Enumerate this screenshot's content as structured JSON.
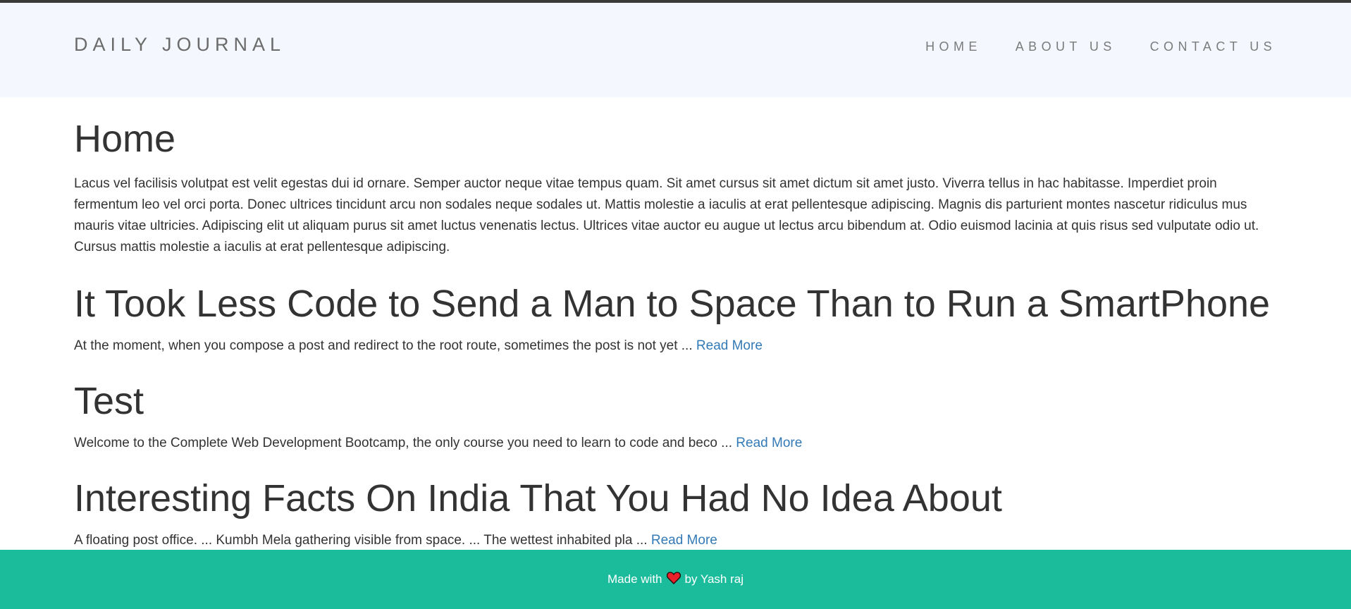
{
  "header": {
    "brand": "DAILY JOURNAL",
    "nav": [
      {
        "label": "HOME"
      },
      {
        "label": "ABOUT US"
      },
      {
        "label": "CONTACT US"
      }
    ]
  },
  "main": {
    "title": "Home",
    "intro": "Lacus vel facilisis volutpat est velit egestas dui id ornare. Semper auctor neque vitae tempus quam. Sit amet cursus sit amet dictum sit amet justo. Viverra tellus in hac habitasse. Imperdiet proin fermentum leo vel orci porta. Donec ultrices tincidunt arcu non sodales neque sodales ut. Mattis molestie a iaculis at erat pellentesque adipiscing. Magnis dis parturient montes nascetur ridiculus mus mauris vitae ultricies. Adipiscing elit ut aliquam purus sit amet luctus venenatis lectus. Ultrices vitae auctor eu augue ut lectus arcu bibendum at. Odio euismod lacinia at quis risus sed vulputate odio ut. Cursus mattis molestie a iaculis at erat pellentesque adipiscing.",
    "posts": [
      {
        "title": "It Took Less Code to Send a Man to Space Than to Run a SmartPhone",
        "excerpt": "At the moment, when you compose a post and redirect to the root route, sometimes the post is not yet ... ",
        "read_more": "Read More"
      },
      {
        "title": "Test",
        "excerpt": "Welcome to the Complete Web Development Bootcamp, the only course you need to learn to code and beco ... ",
        "read_more": "Read More"
      },
      {
        "title": "Interesting Facts On India That You Had No Idea About",
        "excerpt": "A floating post office. ... Kumbh Mela gathering visible from space. ... The wettest inhabited pla ... ",
        "read_more": "Read More"
      }
    ]
  },
  "footer": {
    "made_with": "Made with",
    "heart_icon": "heart-icon",
    "by": "by Yash raj"
  },
  "colors": {
    "navbar_bg": "#f4f7fe",
    "footer_bg": "#1abc9c",
    "link": "#337ab7",
    "heart": "#e8212b"
  }
}
